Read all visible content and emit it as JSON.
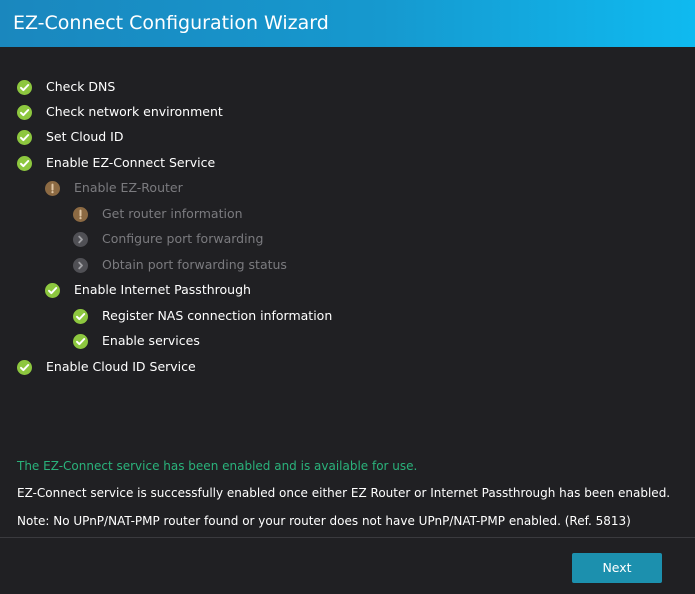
{
  "window": {
    "title": "EZ-Connect Configuration Wizard"
  },
  "steps": [
    {
      "label": "Check DNS",
      "status": "success",
      "icon": "check-circle-icon"
    },
    {
      "label": "Check network environment",
      "status": "success",
      "icon": "check-circle-icon"
    },
    {
      "label": "Set Cloud ID",
      "status": "success",
      "icon": "check-circle-icon"
    },
    {
      "label": "Enable EZ-Connect Service",
      "status": "success",
      "icon": "check-circle-icon"
    },
    {
      "label": "Enable EZ-Router",
      "status": "warning",
      "icon": "exclamation-circle-icon"
    },
    {
      "label": "Get router information",
      "status": "warning",
      "icon": "exclamation-circle-icon"
    },
    {
      "label": "Configure port forwarding",
      "status": "pending",
      "icon": "chevron-circle-icon"
    },
    {
      "label": "Obtain port forwarding status",
      "status": "pending",
      "icon": "chevron-circle-icon"
    },
    {
      "label": "Enable Internet Passthrough",
      "status": "success",
      "icon": "check-circle-icon"
    },
    {
      "label": "Register NAS connection information",
      "status": "success",
      "icon": "check-circle-icon"
    },
    {
      "label": "Enable services",
      "status": "success",
      "icon": "check-circle-icon"
    },
    {
      "label": "Enable Cloud ID Service",
      "status": "success",
      "icon": "check-circle-icon"
    }
  ],
  "messages": {
    "success": "The EZ-Connect service has been enabled and is available for use.",
    "info": "EZ-Connect service is successfully enabled once either EZ Router or Internet Passthrough has been enabled.",
    "note": "Note: No UPnP/NAT-PMP router found or your router does not have UPnP/NAT-PMP enabled. (Ref. 5813)"
  },
  "footer": {
    "next_label": "Next"
  },
  "colors": {
    "titlebar_start": "#1a87be",
    "titlebar_end": "#0fbaf0",
    "background": "#202023",
    "success": "#8dc73f",
    "warning": "#8c6a43",
    "pending": "#505055",
    "success_text": "#2ab27b",
    "button": "#1c90ae"
  }
}
